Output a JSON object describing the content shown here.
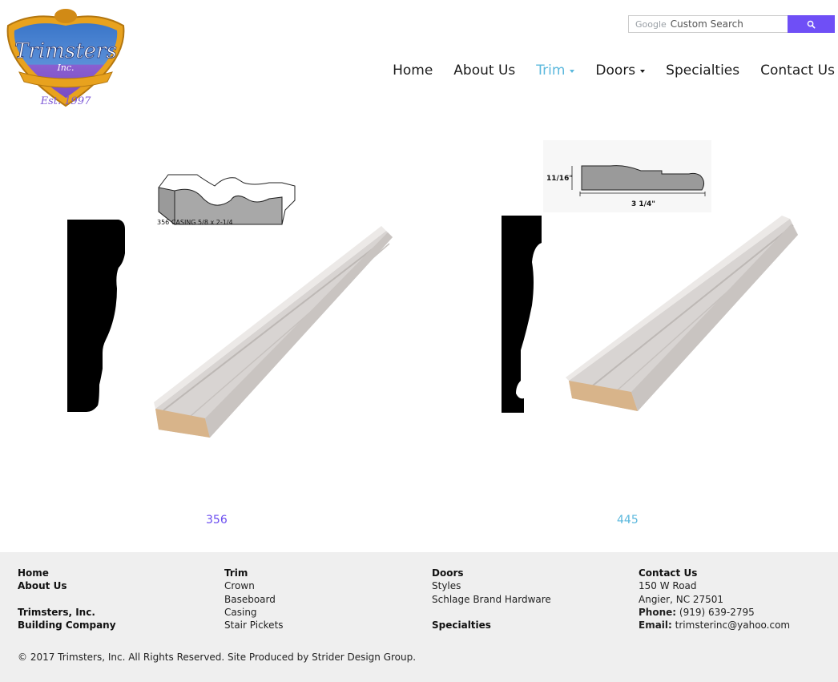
{
  "logo": {
    "name": "Trimsters",
    "sub": "Inc.",
    "est": "Est. 1997"
  },
  "search": {
    "brand": "Google",
    "placeholder": "Custom Search"
  },
  "nav": {
    "home": "Home",
    "about": "About Us",
    "trim": "Trim",
    "doors": "Doors",
    "specialties": "Specialties",
    "contact": "Contact Us"
  },
  "products": [
    {
      "label": "356",
      "profile_caption": "356  CASING  5/8 x 2-1/4"
    },
    {
      "label": "445",
      "dim_height": "11/16\"",
      "dim_width": "3 1/4\""
    }
  ],
  "footer": {
    "col1": {
      "home": "Home",
      "about": "About Us",
      "company1": "Trimsters, Inc.",
      "company2": "Building Company"
    },
    "col2": {
      "title": "Trim",
      "items": [
        "Crown",
        "Baseboard",
        "Casing",
        "Stair Pickets"
      ]
    },
    "col3": {
      "title": "Doors",
      "items": [
        "Styles",
        "Schlage Brand Hardware"
      ],
      "specialties": "Specialties"
    },
    "col4": {
      "title": "Contact Us",
      "address1": "150 W Road",
      "address2": "Angier, NC 27501",
      "phone_label": "Phone:",
      "phone": "(919) 639-2795",
      "email_label": "Email:",
      "email": "trimsterinc@yahoo.com"
    },
    "copyright": "© 2017 Trimsters, Inc. All Rights Reserved. Site Produced by Strider Design Group."
  },
  "colors": {
    "accent": "#6f4ff6",
    "active_nav": "#5bb8dd",
    "footer_bg": "#efefef"
  }
}
